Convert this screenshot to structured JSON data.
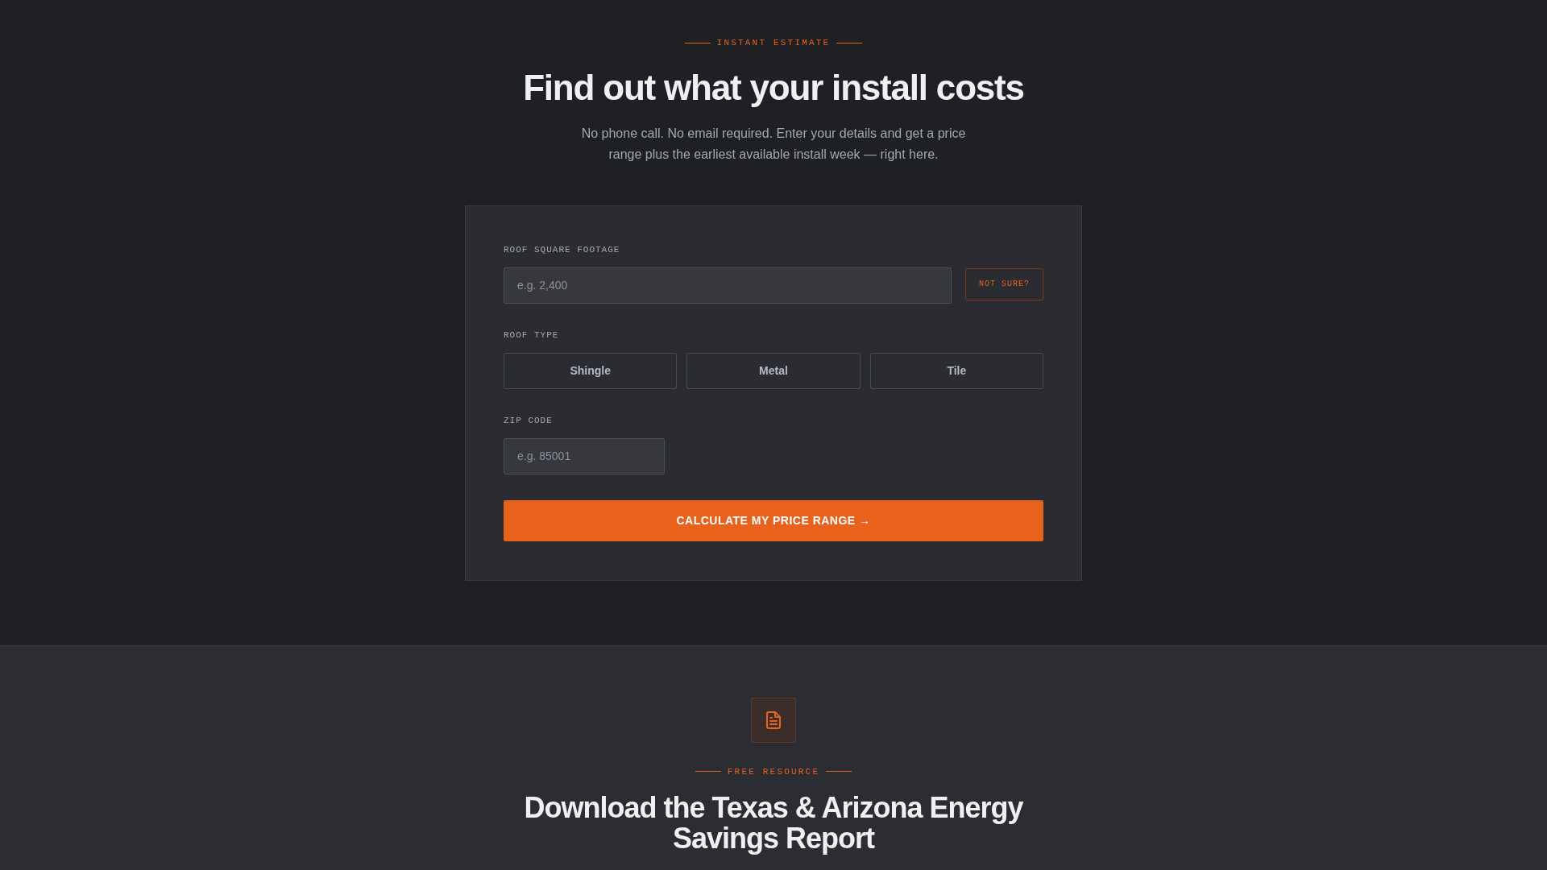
{
  "estimate_section": {
    "eyebrow": "INSTANT ESTIMATE",
    "heading": "Find out what your install costs",
    "intro": "No phone call. No email required. Enter your details and get a price range plus the earliest available install week — right here.",
    "form": {
      "square_footage": {
        "label": "ROOF SQUARE FOOTAGE",
        "placeholder": "e.g. 2,400",
        "help_button": "NOT SURE?"
      },
      "roof_type": {
        "label": "ROOF TYPE",
        "options": [
          {
            "label": "Shingle",
            "selected": false
          },
          {
            "label": "Metal",
            "selected": false
          },
          {
            "label": "Tile",
            "selected": false
          }
        ]
      },
      "zip_code": {
        "label": "ZIP CODE",
        "placeholder": "e.g. 85001"
      },
      "submit_button": "CALCULATE MY PRICE RANGE →"
    }
  },
  "resource_section": {
    "eyebrow": "FREE RESOURCE",
    "heading": "Download the Texas & Arizona Energy Savings Report"
  }
}
